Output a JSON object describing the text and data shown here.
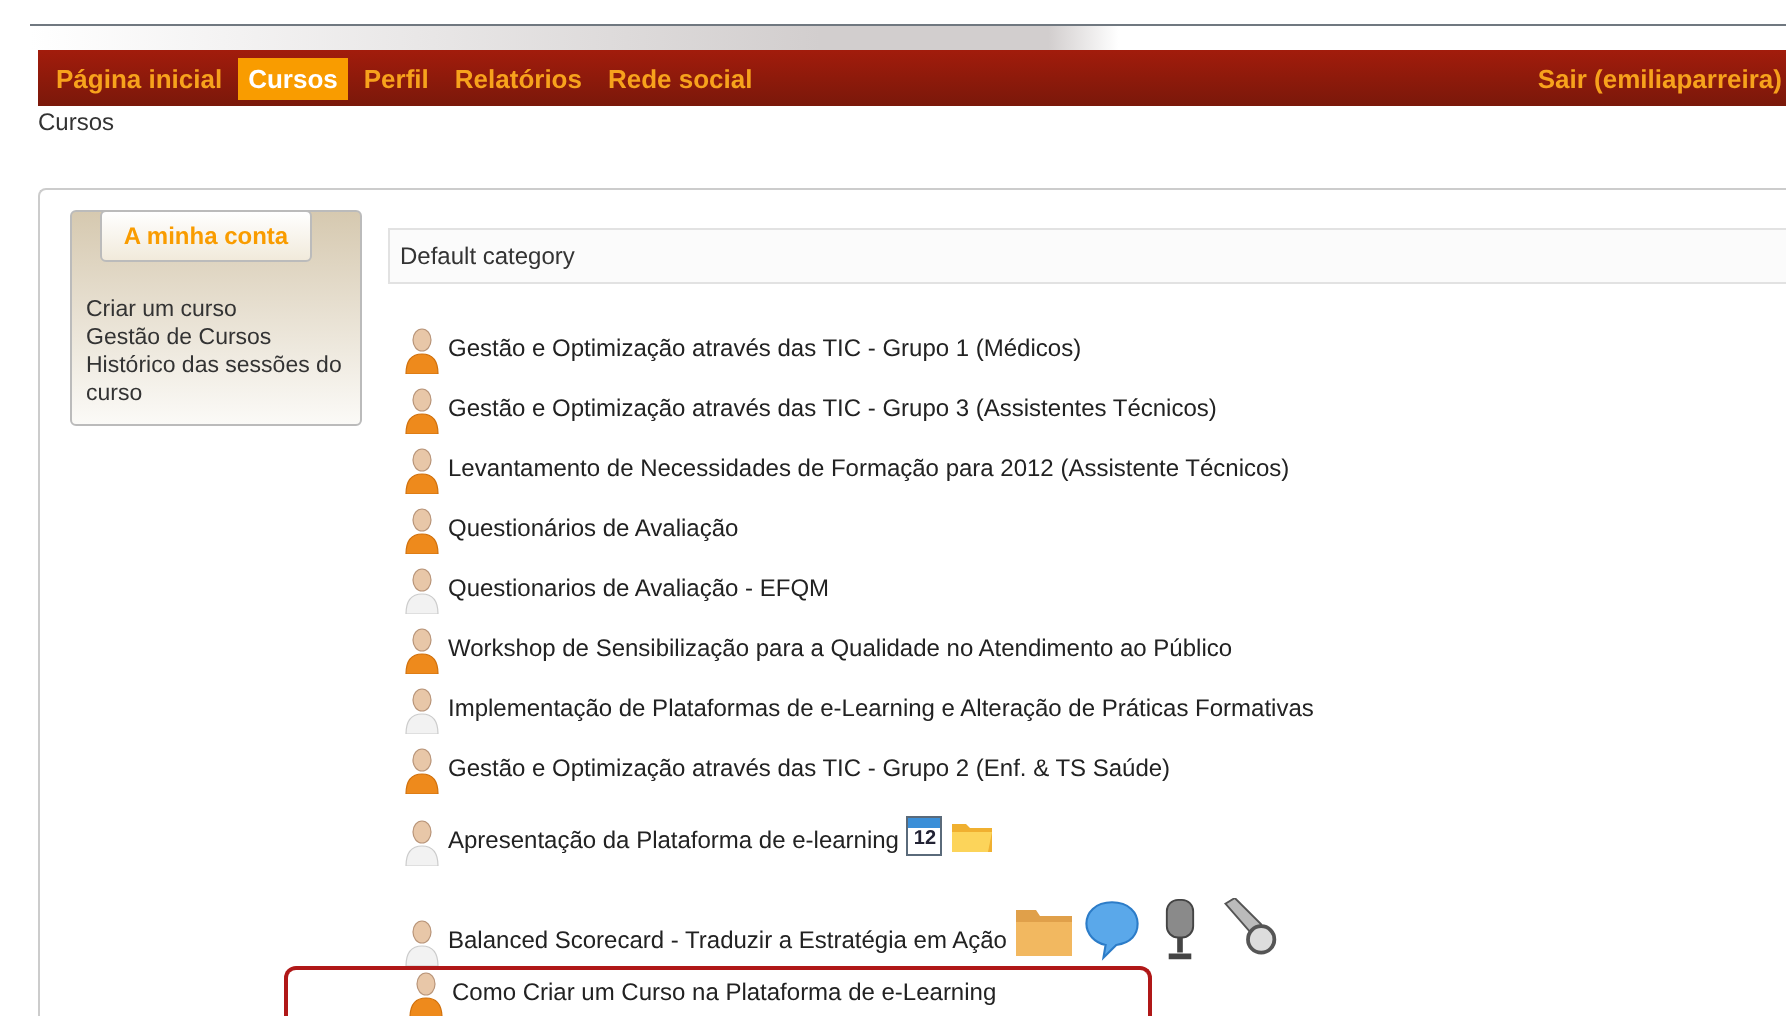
{
  "nav": {
    "items": [
      {
        "label": "Página inicial",
        "selected": false
      },
      {
        "label": "Cursos",
        "selected": true
      },
      {
        "label": "Perfil",
        "selected": false
      },
      {
        "label": "Relatórios",
        "selected": false
      },
      {
        "label": "Rede social",
        "selected": false
      }
    ],
    "logout": "Sair (emiliaparreira)"
  },
  "breadcrumb": "Cursos",
  "sidebar": {
    "title": "A minha conta",
    "links": [
      "Criar um curso",
      "Gestão de Cursos",
      "Histórico das sessões do curso"
    ]
  },
  "category": "Default category",
  "courses": [
    {
      "title": "Gestão e Optimização através das TIC - Grupo 1 (Médicos)",
      "highlighted": true,
      "outlined": false
    },
    {
      "title": "Gestão e Optimização através das TIC - Grupo 3 (Assistentes Técnicos)",
      "highlighted": true,
      "outlined": false
    },
    {
      "title": "Levantamento de Necessidades de Formação para 2012 (Assistente Técnicos)",
      "highlighted": true,
      "outlined": false
    },
    {
      "title": "Questionários de Avaliação",
      "highlighted": true,
      "outlined": false
    },
    {
      "title": "Questionarios de Avaliação - EFQM",
      "highlighted": false,
      "outlined": false
    },
    {
      "title": "Workshop de Sensibilização para a Qualidade no Atendimento ao Público",
      "highlighted": true,
      "outlined": false
    },
    {
      "title": "Implementação de Plataformas de e-Learning e Alteração de Práticas Formativas",
      "highlighted": false,
      "outlined": false
    },
    {
      "title": "Gestão e Optimização através das TIC - Grupo 2 (Enf. & TS Saúde)",
      "highlighted": true,
      "outlined": false
    },
    {
      "title": "Apresentação da Plataforma de e-learning",
      "highlighted": false,
      "outlined": false,
      "tools": [
        {
          "kind": "calendar",
          "label": "12"
        },
        {
          "kind": "folder"
        }
      ]
    },
    {
      "title": "Balanced Scorecard - Traduzir a Estratégia em Ação",
      "highlighted": false,
      "outlined": false,
      "tools": [
        {
          "kind": "bigfolder"
        },
        {
          "kind": "chat"
        },
        {
          "kind": "microphone"
        },
        {
          "kind": "flashlight"
        }
      ]
    },
    {
      "title": "Como Criar um Curso na Plataforma de e-Learning",
      "highlighted": true,
      "outlined": true
    }
  ]
}
